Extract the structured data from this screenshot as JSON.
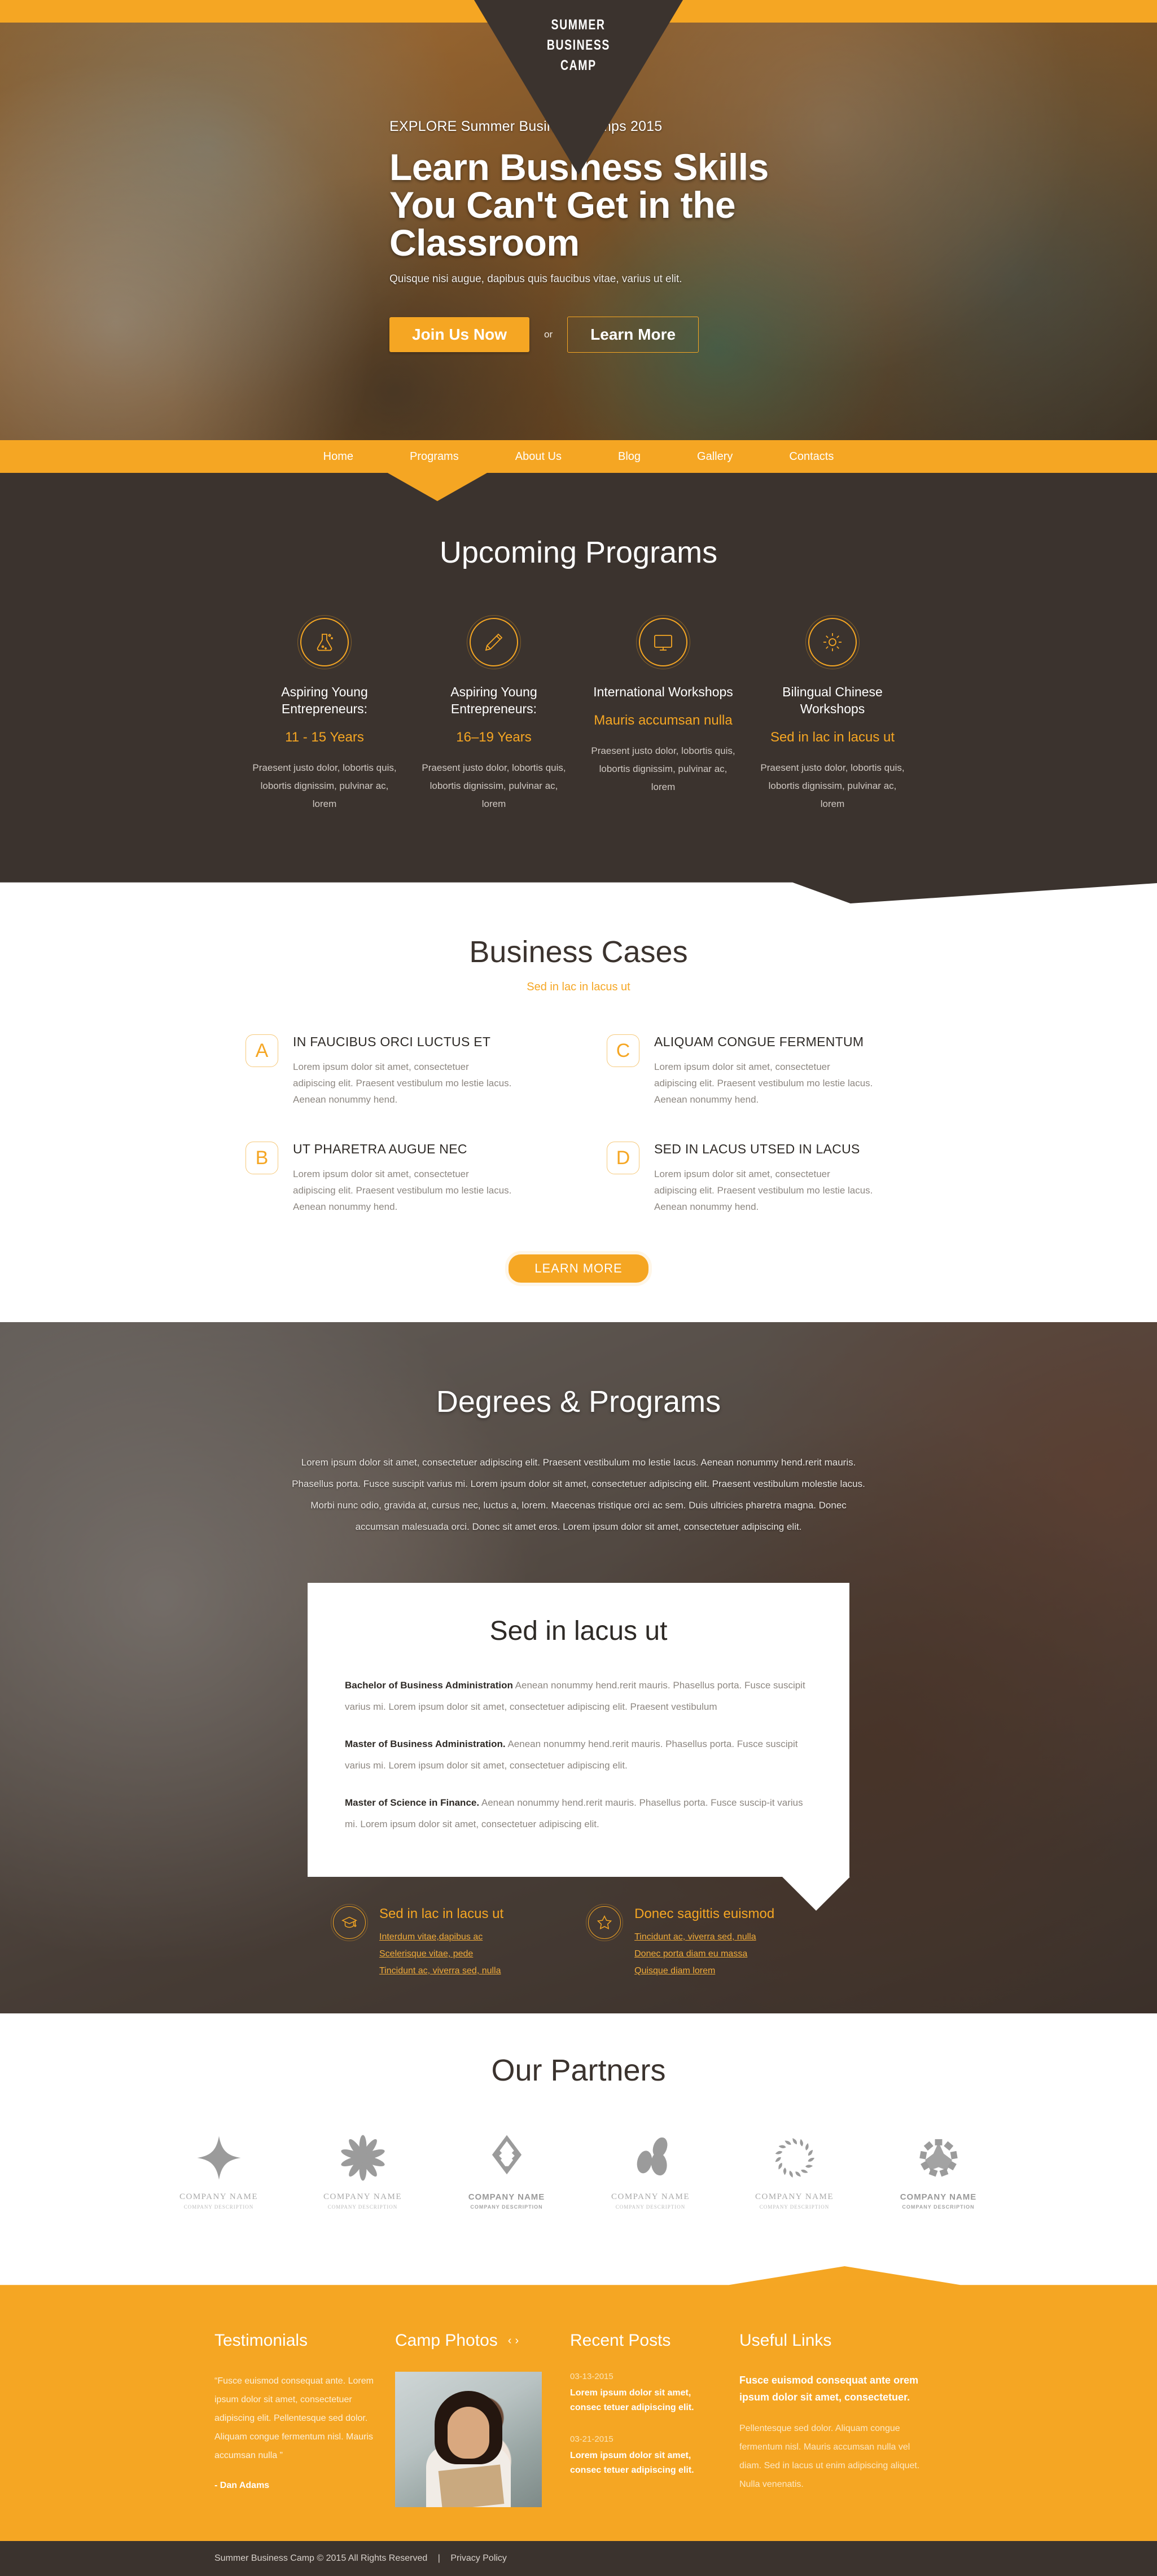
{
  "brand": {
    "line1": "SUMMER",
    "line2": "BUSINESS",
    "line3": "CAMP"
  },
  "colors": {
    "accent": "#f5a623",
    "dark": "#3b332e",
    "body_text": "#8d8781"
  },
  "hero": {
    "eyebrow": "EXPLORE Summer Business Camps 2015",
    "title": "Learn Business Skills You Can't Get in the Classroom",
    "subtitle": "Quisque nisi augue, dapibus quis faucibus vitae, varius ut elit.",
    "primary_button": "Join Us Now",
    "or_label": "or",
    "secondary_button": "Learn More"
  },
  "nav": {
    "items": [
      {
        "label": "Home"
      },
      {
        "label": "Programs"
      },
      {
        "label": "About Us"
      },
      {
        "label": "Blog"
      },
      {
        "label": "Gallery"
      },
      {
        "label": "Contacts"
      }
    ]
  },
  "programs": {
    "heading": "Upcoming Programs",
    "cards": [
      {
        "icon": "flask-icon",
        "name": "Aspiring Young Entrepreneurs:",
        "age": "11 - 15 Years",
        "desc": "Praesent justo dolor, lobortis quis, lobortis dignissim, pulvinar ac, lorem"
      },
      {
        "icon": "pencil-icon",
        "name": "Aspiring Young Entrepreneurs:",
        "age": "16–19 Years",
        "desc": "Praesent justo dolor, lobortis quis, lobortis dignissim, pulvinar ac, lorem"
      },
      {
        "icon": "monitor-icon",
        "name": "International Workshops",
        "age": "Mauris accumsan nulla",
        "desc": "Praesent justo dolor, lobortis quis, lobortis dignissim, pulvinar ac, lorem"
      },
      {
        "icon": "gear-icon",
        "name": "Bilingual Chinese Workshops",
        "age": "Sed in lac in lacus ut",
        "desc": "Praesent justo dolor, lobortis quis, lobortis dignissim, pulvinar ac, lorem"
      }
    ]
  },
  "cases": {
    "heading": "Business Cases",
    "subheading": "Sed in lac in lacus ut",
    "items": [
      {
        "badge": "A",
        "title": "IN FAUCIBUS ORCI LUCTUS ET",
        "text": "Lorem ipsum dolor sit amet, consectetuer adipiscing elit. Praesent vestibulum mo lestie lacus. Aenean nonummy hend."
      },
      {
        "badge": "C",
        "title": "ALIQUAM CONGUE FERMENTUM",
        "text": "Lorem ipsum dolor sit amet, consectetuer adipiscing elit. Praesent vestibulum mo lestie lacus. Aenean nonummy hend."
      },
      {
        "badge": "B",
        "title": "UT PHARETRA AUGUE NEC",
        "text": "Lorem ipsum dolor sit amet, consectetuer adipiscing elit. Praesent vestibulum mo lestie lacus. Aenean nonummy hend."
      },
      {
        "badge": "D",
        "title": "SED IN LACUS UTSED IN LACUS",
        "text": "Lorem ipsum dolor sit amet, consectetuer adipiscing elit. Praesent vestibulum mo lestie lacus. Aenean nonummy hend."
      }
    ],
    "button": "LEARN MORE"
  },
  "degrees": {
    "heading": "Degrees & Programs",
    "intro": "Lorem ipsum dolor sit amet, consectetuer adipiscing elit. Praesent vestibulum mo lestie lacus. Aenean nonummy hend.rerit mauris. Phasellus porta. Fusce suscipit varius mi. Lorem ipsum dolor sit amet, consectetuer adipiscing elit. Praesent vestibulum molestie lacus. Morbi nunc odio, gravida at, cursus nec, luctus a, lorem. Maecenas tristique orci ac sem. Duis ultricies pharetra magna. Donec accumsan malesuada orci. Donec sit amet eros. Lorem ipsum dolor sit amet, consectetuer adipiscing elit.",
    "card_title": "Sed in lacus ut",
    "entries": [
      {
        "label": "Bachelor of Business Administration",
        "text": " Aenean nonummy hend.rerit mauris. Phasellus porta. Fusce suscipit varius mi. Lorem ipsum dolor sit amet, consectetuer adipiscing elit. Praesent vestibulum"
      },
      {
        "label": "Master of Business Administration.",
        "text": " Aenean nonummy hend.rerit mauris. Phasellus porta. Fusce suscipit varius mi. Lorem ipsum dolor sit amet, consectetuer adipiscing elit."
      },
      {
        "label": "Master of Science in Finance.",
        "text": " Aenean nonummy hend.rerit mauris. Phasellus porta. Fusce suscip-it varius mi. Lorem ipsum dolor sit amet, consectetuer adipiscing elit."
      }
    ],
    "features": [
      {
        "icon": "graduation-cap-icon",
        "title": "Sed in lac in lacus ut",
        "links": [
          "Interdum vitae,dapibus ac",
          "Scelerisque vitae, pede",
          "Tincidunt ac, viverra sed, nulla"
        ]
      },
      {
        "icon": "star-icon",
        "title": "Donec sagittis euismod",
        "links": [
          "Tincidunt ac, viverra sed, nulla",
          "Donec porta diam eu massa",
          "Quisque diam lorem"
        ]
      }
    ]
  },
  "partners": {
    "heading": "Our Partners",
    "logos": [
      {
        "icon": "four-point-star-logo",
        "name": "COMPANY NAME",
        "desc": "COMPANY DESCRIPTION",
        "style": "serif"
      },
      {
        "icon": "pinwheel-logo",
        "name": "COMPANY NAME",
        "desc": "COMPANY DESCRIPTION",
        "style": "serif"
      },
      {
        "icon": "diamond-bracket-logo",
        "name": "COMPANY NAME",
        "desc": "COMPANY DESCRIPTION",
        "style": "sans"
      },
      {
        "icon": "petals-logo",
        "name": "COMPANY NAME",
        "desc": "COMPANY DESCRIPTION",
        "style": "serif"
      },
      {
        "icon": "sun-ring-logo",
        "name": "COMPANY NAME",
        "desc": "COMPANY DESCRIPTION",
        "style": "serif"
      },
      {
        "icon": "starburst-logo",
        "name": "COMPANY NAME",
        "desc": "COMPANY DESCRIPTION",
        "style": "sans"
      }
    ]
  },
  "footer": {
    "testimonials": {
      "heading": "Testimonials",
      "quote": "“Fusce euismod consequat ante. Lorem ipsum dolor sit amet, consectetuer adipiscing elit. Pellentesque sed dolor. Aliquam congue fermentum nisl. Mauris accumsan nulla ”",
      "author": "- Dan Adams"
    },
    "photos": {
      "heading": "Camp Photos",
      "prev": "‹",
      "next": "›",
      "image_alt": "student-photo"
    },
    "posts": {
      "heading": "Recent Posts",
      "items": [
        {
          "date": "03-13-2015",
          "text": "Lorem ipsum dolor sit amet, consec tetuer adipiscing elit."
        },
        {
          "date": "03-21-2015",
          "text": "Lorem ipsum dolor sit amet, consec tetuer adipiscing elit."
        }
      ]
    },
    "links": {
      "heading": "Useful Links",
      "lead": "Fusce euismod consequat ante orem ipsum dolor sit amet, consectetuer.",
      "body": "Pellentesque sed dolor. Aliquam congue fermentum nisl. Mauris accumsan nulla vel diam. Sed in lacus ut enim adipiscing aliquet. Nulla venenatis."
    },
    "copyright": "Summer Business Camp © 2015 All Rights Reserved",
    "separator": "|",
    "privacy": "Privacy Policy"
  }
}
